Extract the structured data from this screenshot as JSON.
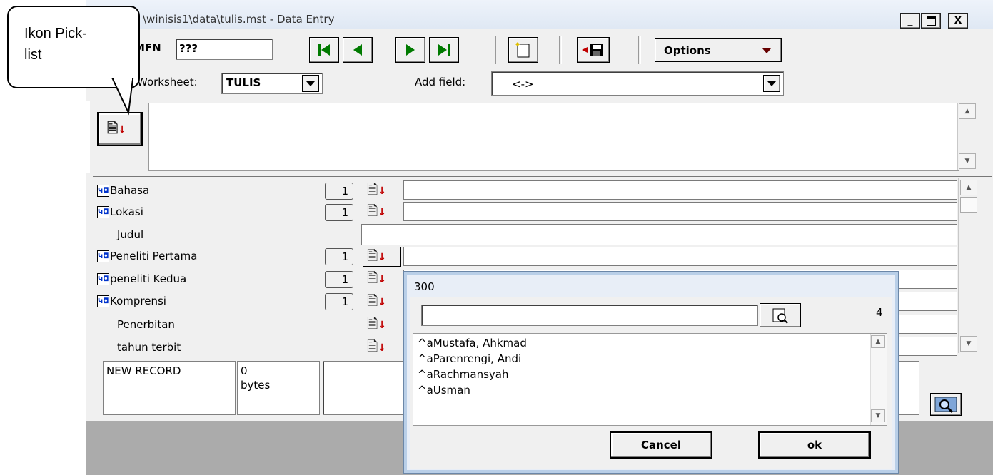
{
  "window": {
    "title": "\\winisis1\\data\\tulis.mst - Data Entry",
    "minimize": "_",
    "maximize": "□",
    "close": "X"
  },
  "toolbar": {
    "mfn_label": "MFN",
    "mfn_value": "???",
    "options_label": "Options"
  },
  "worksheet": {
    "label": "Worksheet:",
    "value": "TULIS",
    "add_field_label": "Add field:",
    "add_field_value": "<->"
  },
  "fields": [
    {
      "label": "Bahasa",
      "occ": "1",
      "has_icon": true
    },
    {
      "label": "Lokasi",
      "occ": "1",
      "has_icon": true
    },
    {
      "label": "Judul",
      "occ": "",
      "has_icon": false
    },
    {
      "label": "Peneliti Pertama",
      "occ": "1",
      "has_icon": true
    },
    {
      "label": "peneliti Kedua",
      "occ": "1",
      "has_icon": true
    },
    {
      "label": "Komprensi",
      "occ": "1",
      "has_icon": true
    },
    {
      "label": "Penerbitan",
      "occ": "",
      "has_icon": false
    },
    {
      "label": "tahun terbit",
      "occ": "",
      "has_icon": false
    }
  ],
  "status": {
    "record": "NEW RECORD",
    "size_value": "0",
    "size_unit": "bytes"
  },
  "picklist": {
    "title": "300",
    "search_value": "",
    "count": "4",
    "items": [
      "^aMustafa, Ahkmad",
      "^aParenrengi, Andi",
      "^aRachmansyah",
      "^aUsman"
    ],
    "cancel_label": "Cancel",
    "ok_label": "ok"
  },
  "callout": {
    "line1": "Ikon Pick-",
    "line2": "list"
  }
}
